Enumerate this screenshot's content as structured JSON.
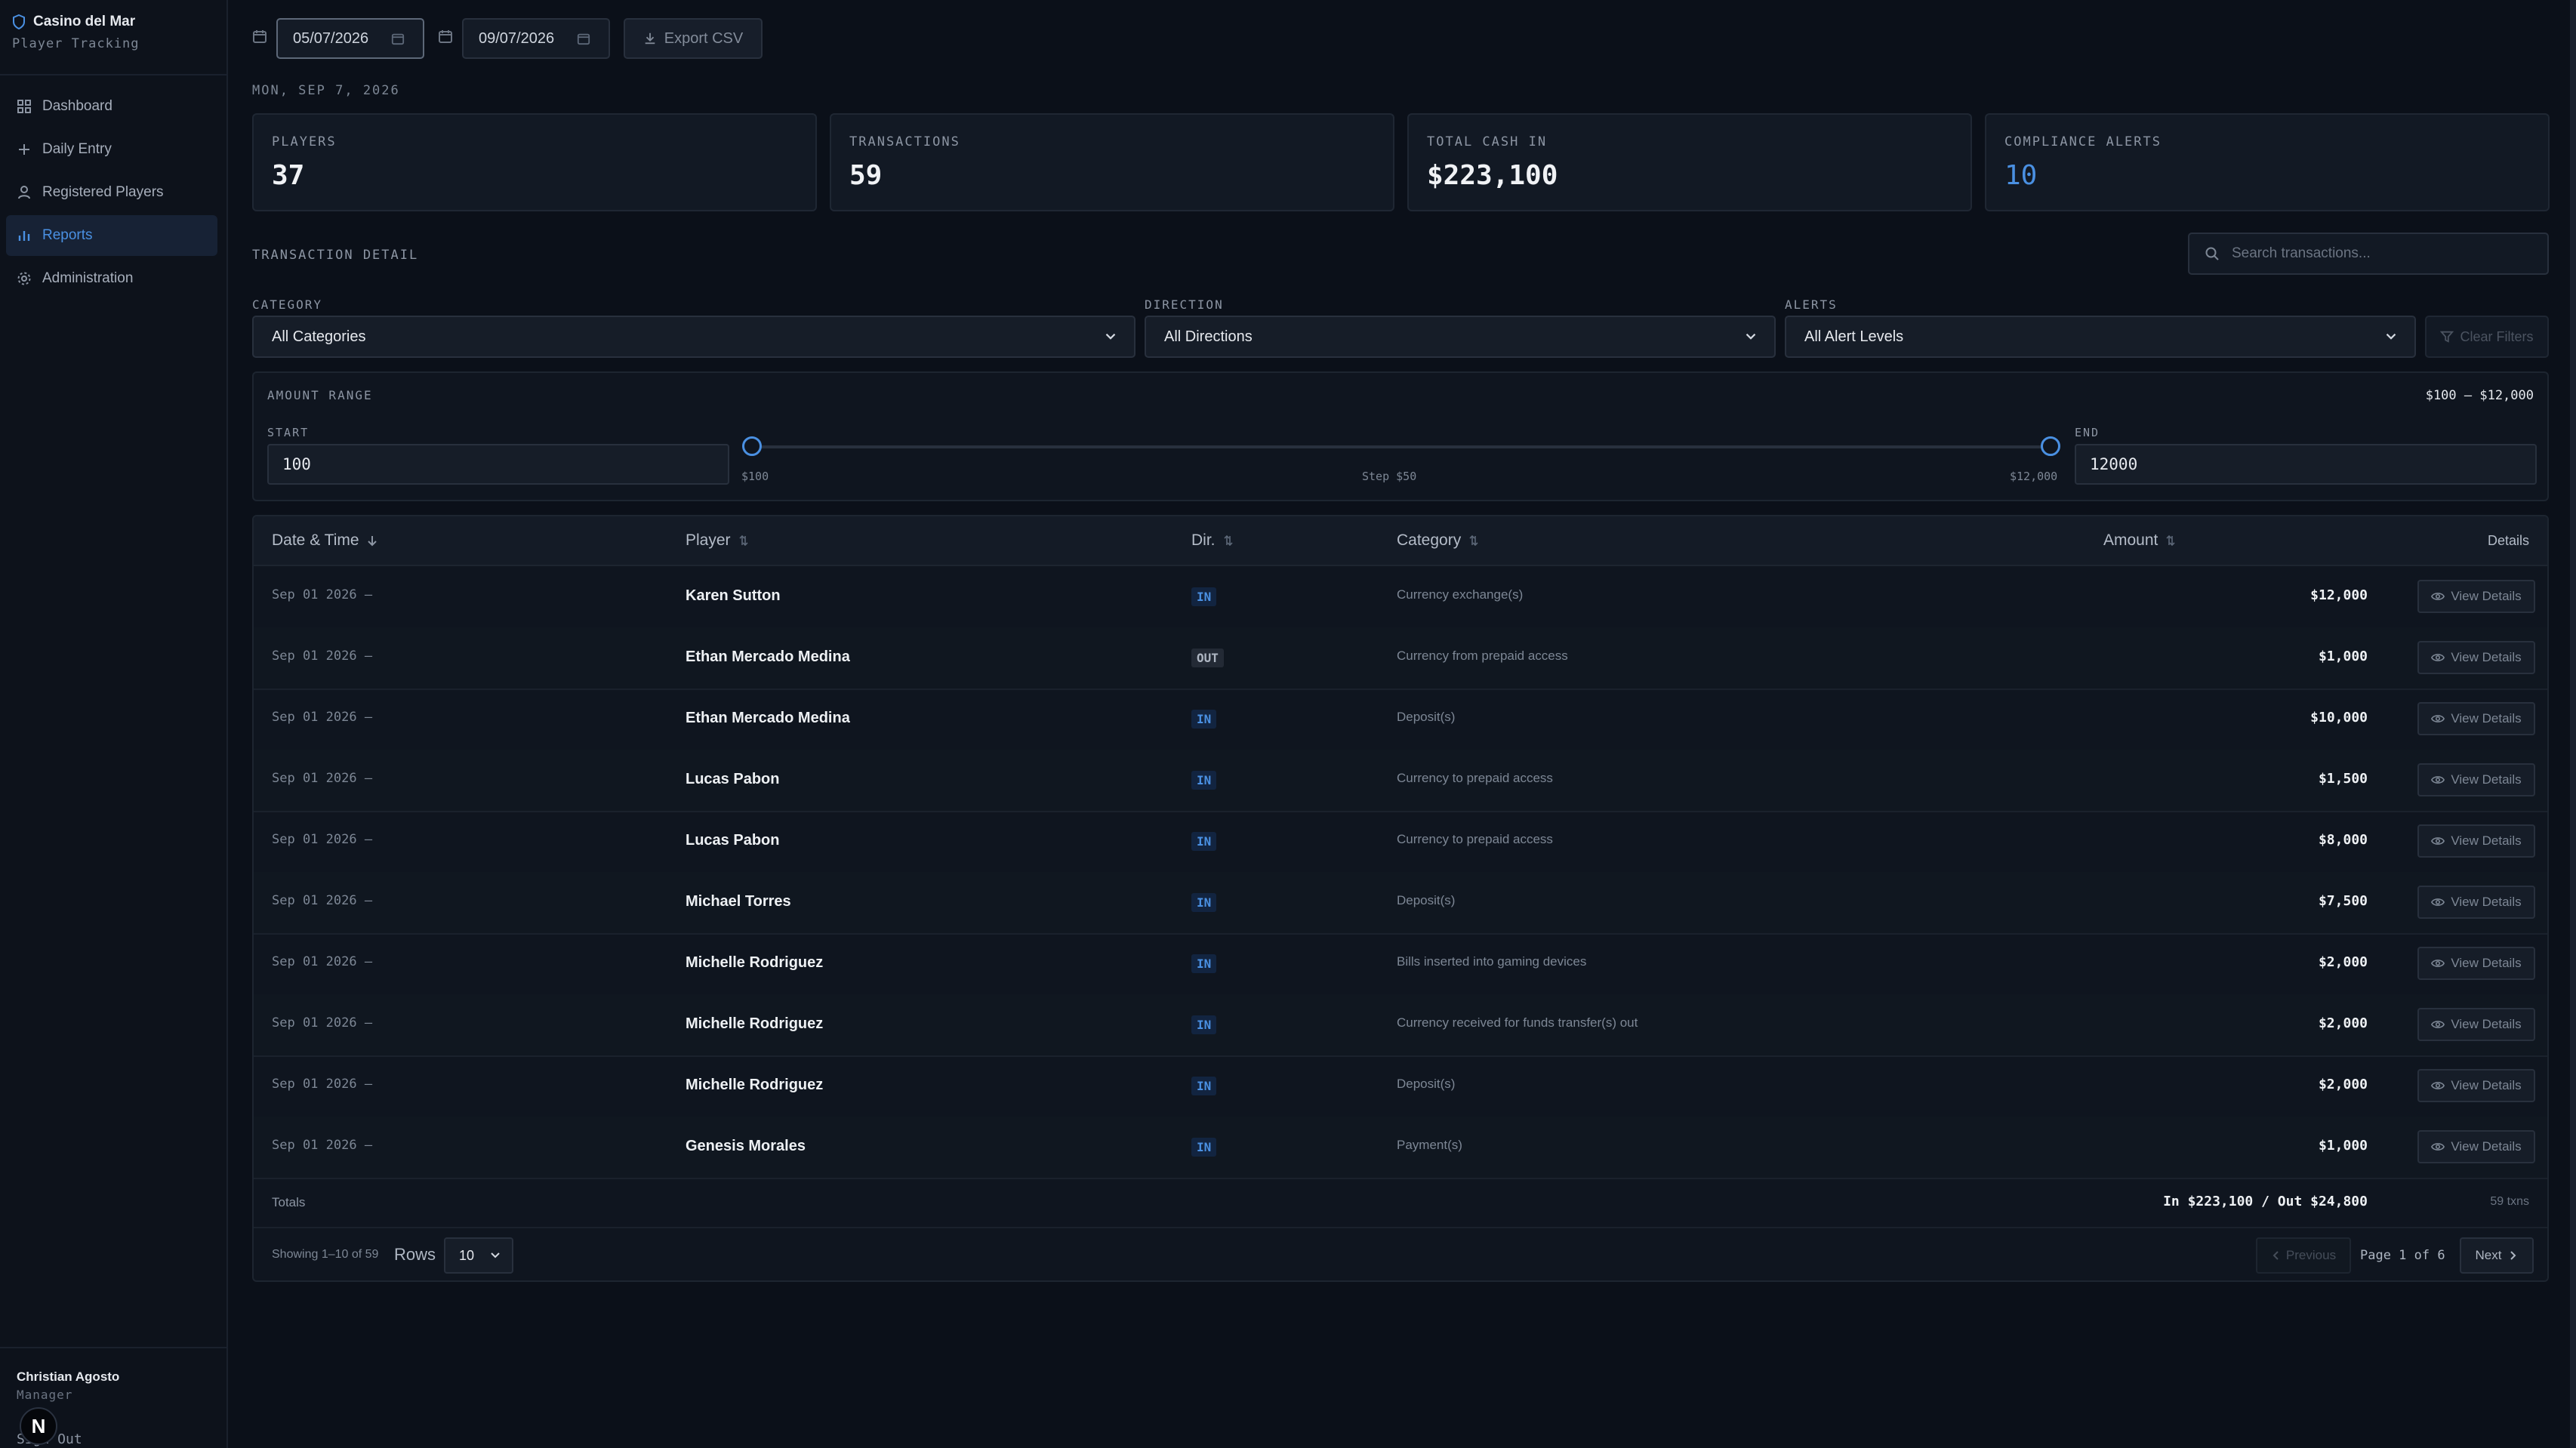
{
  "app": {
    "name": "Casino del Mar",
    "subtitle": "Player Tracking"
  },
  "colors": {
    "accent": "#4a90e2",
    "background": "#0b1019",
    "panel": "#121924"
  },
  "sidebar": {
    "items": [
      {
        "label": "Dashboard",
        "icon": "grid-icon",
        "active": false
      },
      {
        "label": "Daily Entry",
        "icon": "plus-icon",
        "active": false
      },
      {
        "label": "Registered Players",
        "icon": "user-icon",
        "active": false
      },
      {
        "label": "Reports",
        "icon": "bar-chart-icon",
        "active": true
      },
      {
        "label": "Administration",
        "icon": "gear-icon",
        "active": false
      }
    ],
    "user": {
      "name": "Christian Agosto",
      "role": "Manager",
      "avatar_letter": "N",
      "signout": "Sign Out"
    }
  },
  "toolbar": {
    "date_from": "05/07/2026",
    "date_to": "09/07/2026",
    "export_label": "Export CSV",
    "current_date": "MON, SEP 7, 2026"
  },
  "stats": [
    {
      "label": "PLAYERS",
      "value": "37"
    },
    {
      "label": "TRANSACTIONS",
      "value": "59"
    },
    {
      "label": "TOTAL CASH IN",
      "value": "$223,100"
    },
    {
      "label": "COMPLIANCE ALERTS",
      "value": "10"
    }
  ],
  "section": {
    "title": "TRANSACTION DETAIL",
    "search_placeholder": "Search transactions..."
  },
  "filters": {
    "category": {
      "label": "CATEGORY",
      "value": "All Categories"
    },
    "direction": {
      "label": "DIRECTION",
      "value": "All Directions"
    },
    "alerts": {
      "label": "ALERTS",
      "value": "All Alert Levels"
    },
    "clear_label": "Clear Filters"
  },
  "range": {
    "title": "AMOUNT RANGE",
    "summary": "$100 – $12,000",
    "start_label": "START",
    "start_value": "100",
    "end_label": "END",
    "end_value": "12000",
    "min_label": "$100",
    "step_label": "Step $50",
    "max_label": "$12,000",
    "slider_min": 100,
    "slider_max": 12000,
    "selected_low": 100,
    "selected_high": 12000
  },
  "table": {
    "columns": {
      "date": "Date & Time",
      "player": "Player",
      "dir": "Dir.",
      "category": "Category",
      "amount": "Amount",
      "details": "Details"
    },
    "view_label": "View Details",
    "rows": [
      {
        "date": "Sep 01 2026 —",
        "player": "Karen Sutton",
        "dir": "IN",
        "category": "Currency exchange(s)",
        "amount": "$12,000"
      },
      {
        "date": "Sep 01 2026 —",
        "player": "Ethan Mercado Medina",
        "dir": "OUT",
        "category": "Currency from prepaid access",
        "amount": "$1,000"
      },
      {
        "date": "Sep 01 2026 —",
        "player": "Ethan Mercado Medina",
        "dir": "IN",
        "category": "Deposit(s)",
        "amount": "$10,000"
      },
      {
        "date": "Sep 01 2026 —",
        "player": "Lucas Pabon",
        "dir": "IN",
        "category": "Currency to prepaid access",
        "amount": "$1,500"
      },
      {
        "date": "Sep 01 2026 —",
        "player": "Lucas Pabon",
        "dir": "IN",
        "category": "Currency to prepaid access",
        "amount": "$8,000"
      },
      {
        "date": "Sep 01 2026 —",
        "player": "Michael Torres",
        "dir": "IN",
        "category": "Deposit(s)",
        "amount": "$7,500"
      },
      {
        "date": "Sep 01 2026 —",
        "player": "Michelle Rodriguez",
        "dir": "IN",
        "category": "Bills inserted into gaming devices",
        "amount": "$2,000"
      },
      {
        "date": "Sep 01 2026 —",
        "player": "Michelle Rodriguez",
        "dir": "IN",
        "category": "Currency received for funds transfer(s) out",
        "amount": "$2,000"
      },
      {
        "date": "Sep 01 2026 —",
        "player": "Michelle Rodriguez",
        "dir": "IN",
        "category": "Deposit(s)",
        "amount": "$2,000"
      },
      {
        "date": "Sep 01 2026 —",
        "player": "Genesis Morales",
        "dir": "IN",
        "category": "Payment(s)",
        "amount": "$1,000"
      }
    ],
    "totals": {
      "label": "Totals",
      "value": "In $223,100 / Out $24,800",
      "count": "59 txns"
    },
    "footer": {
      "showing": "Showing 1–10 of 59",
      "rows_label": "Rows",
      "rows_value": "10",
      "prev_label": "Previous",
      "page_info": "Page 1 of 6",
      "next_label": "Next"
    }
  }
}
